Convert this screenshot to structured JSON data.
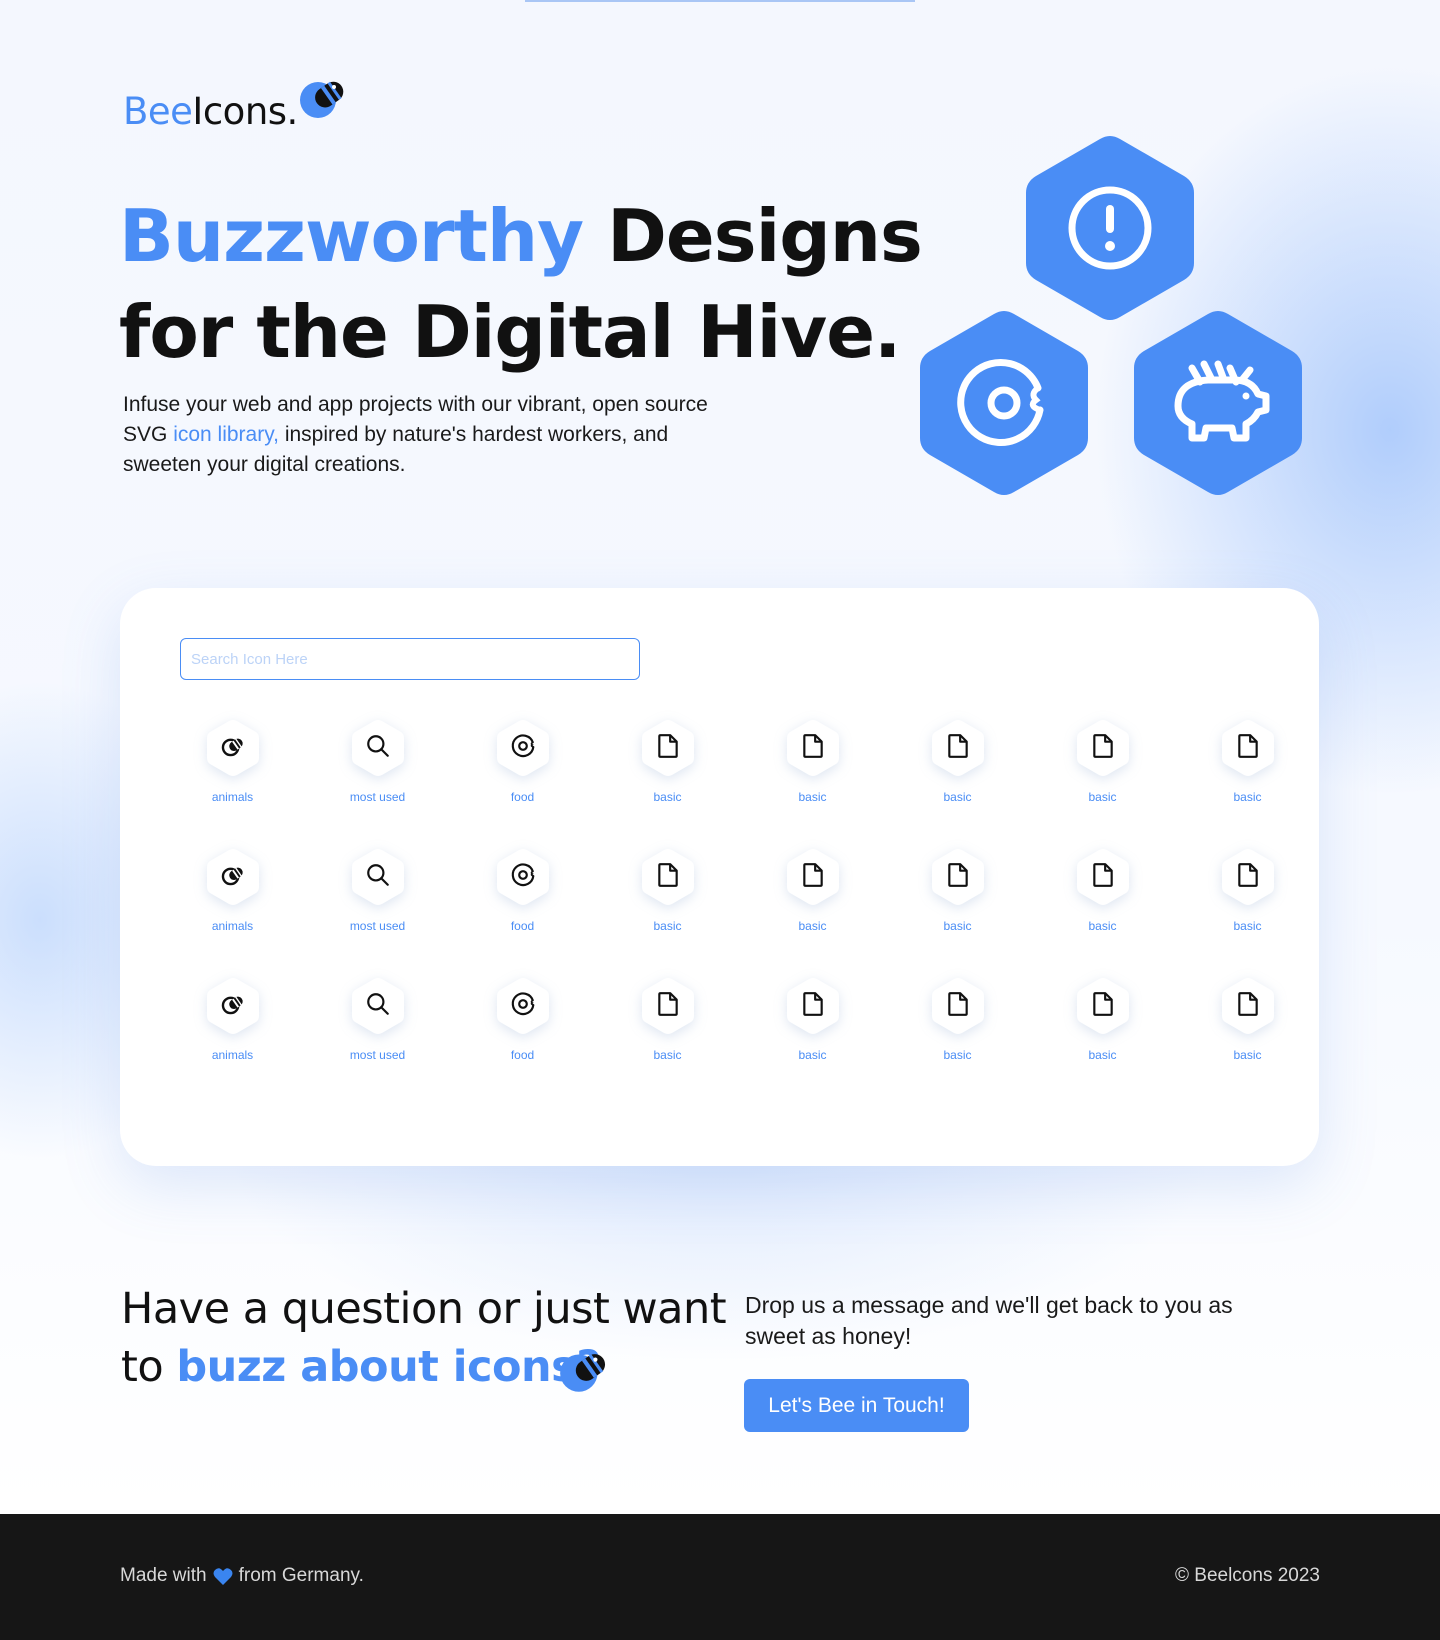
{
  "logo": {
    "part1": "Bee",
    "part2": "Icons."
  },
  "hero": {
    "title_highlight": "Buzzworthy",
    "title_rest_line1": "Designs",
    "title_line2": "for the Digital Hive.",
    "desc_before": "Infuse your web and app projects with our vibrant, open source SVG ",
    "desc_link": "icon library,",
    "desc_after": " inspired by nature's hardest workers, and sweeten your digital creations.",
    "hex_icons": [
      "alert-circle-icon",
      "donut-icon",
      "piggy-bank-icon"
    ]
  },
  "search": {
    "placeholder": "Search Icon Here",
    "value": ""
  },
  "icon_grid": {
    "rows": [
      [
        {
          "icon": "bee-icon",
          "label": "animals"
        },
        {
          "icon": "search-icon",
          "label": "most used"
        },
        {
          "icon": "donut-icon",
          "label": "food"
        },
        {
          "icon": "file-icon",
          "label": "basic"
        },
        {
          "icon": "file-icon",
          "label": "basic"
        },
        {
          "icon": "file-icon",
          "label": "basic"
        },
        {
          "icon": "file-icon",
          "label": "basic"
        },
        {
          "icon": "file-icon",
          "label": "basic"
        }
      ],
      [
        {
          "icon": "bee-icon",
          "label": "animals"
        },
        {
          "icon": "search-icon",
          "label": "most used"
        },
        {
          "icon": "donut-icon",
          "label": "food"
        },
        {
          "icon": "file-icon",
          "label": "basic"
        },
        {
          "icon": "file-icon",
          "label": "basic"
        },
        {
          "icon": "file-icon",
          "label": "basic"
        },
        {
          "icon": "file-icon",
          "label": "basic"
        },
        {
          "icon": "file-icon",
          "label": "basic"
        }
      ],
      [
        {
          "icon": "bee-icon",
          "label": "animals"
        },
        {
          "icon": "search-icon",
          "label": "most used"
        },
        {
          "icon": "donut-icon",
          "label": "food"
        },
        {
          "icon": "file-icon",
          "label": "basic"
        },
        {
          "icon": "file-icon",
          "label": "basic"
        },
        {
          "icon": "file-icon",
          "label": "basic"
        },
        {
          "icon": "file-icon",
          "label": "basic"
        },
        {
          "icon": "file-icon",
          "label": "basic"
        }
      ]
    ]
  },
  "contact": {
    "title_line1": "Have a question or just want",
    "title_line2_prefix": "to ",
    "title_line2_highlight": "buzz about icons?",
    "desc": "Drop us a message and we'll get back to you as sweet as honey!",
    "button_label": "Let's Bee in Touch!"
  },
  "footer": {
    "made_with_prefix": "Made with",
    "made_with_suffix": "from Germany.",
    "heart_icon": "blue-heart-icon",
    "copyright": "© Beelcons 2023"
  },
  "colors": {
    "accent": "#4a8df5",
    "footer_bg": "#161616",
    "text": "#111111"
  }
}
